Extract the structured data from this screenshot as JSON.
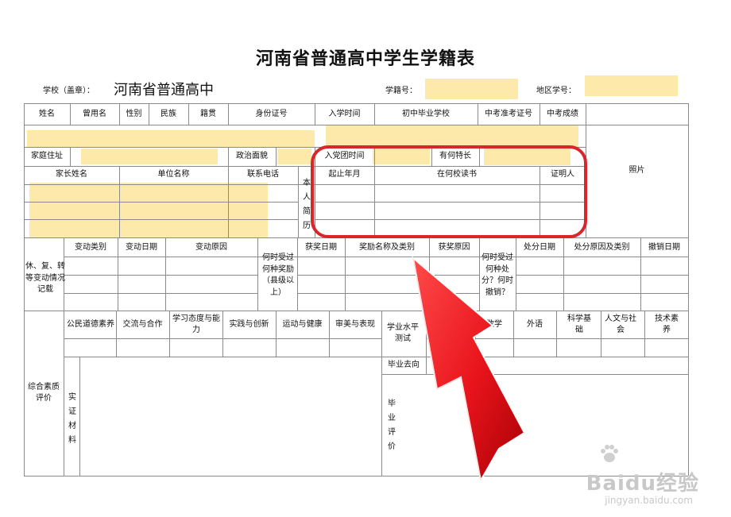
{
  "form": {
    "title": "河南省普通高中学生学籍表",
    "school_label": "学校（盖章）：",
    "school_name": "河南省普通高中",
    "student_no_label": "学籍号：",
    "region_no_label": "地区学号："
  },
  "basic": {
    "name": "姓名",
    "former_name": "曾用名",
    "gender": "性别",
    "ethnicity": "民族",
    "native_place": "籍贯",
    "id_number": "身份证号",
    "enroll_time": "入学时间",
    "junior_school": "初中毕业学校",
    "exam_ticket": "中考准考证号",
    "exam_score": "中考成绩",
    "photo": "照片",
    "home_address": "家庭住址",
    "political_status": "政治面貌",
    "league_time": "入党团时间",
    "specialty": "有何特长"
  },
  "family": {
    "parent_name": "家长姓名",
    "work_unit": "单位名称",
    "phone": "联系电话"
  },
  "resume": {
    "label": "本人简历",
    "period": "起止年月",
    "school": "在何校读书",
    "witness": "证明人"
  },
  "changes": {
    "label": "休、复、转等变动情况记载",
    "type": "变动类别",
    "date": "变动日期",
    "reason": "变动原因",
    "reward_q": "何时受过何种奖励（县级以上）",
    "reward_date": "获奖日期",
    "reward_name": "奖励名称及类别",
    "reward_reason": "获奖原因",
    "punish_q": "何时受过何种处分？何时撤销？",
    "punish_date": "处分日期",
    "punish_reason": "处分原因及类别",
    "revoke_date": "撤销日期"
  },
  "quality": {
    "label": "综合素质评价",
    "civic": "公民道德素养",
    "communication": "交流与合作",
    "attitude": "学习态度与能力",
    "practice": "实践与创新",
    "sports": "运动与健康",
    "aesthetics": "审美与表现",
    "evidence": "实证材料",
    "academic_test": "学业水平测试",
    "math": "数学",
    "foreign": "外语",
    "science": "科学基础",
    "humanities": "人文与社会",
    "tech": "技术素养",
    "destination": "毕业去向",
    "graduation_eval": "毕业评价"
  },
  "watermark": {
    "brand": "Baidu经验",
    "url": "jingyan.baidu.com"
  },
  "colors": {
    "highlight": "#fde9a9",
    "annotation": "#d9262b",
    "arrow": "#e8141b"
  }
}
